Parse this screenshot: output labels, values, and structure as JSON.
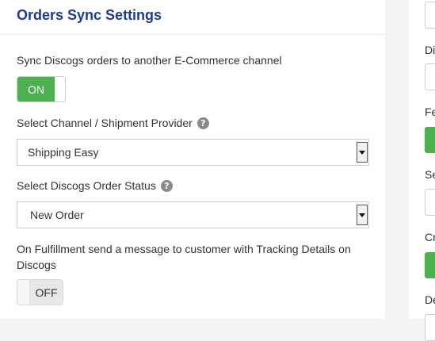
{
  "panel": {
    "title": "Orders Sync Settings"
  },
  "sync": {
    "label": "Sync Discogs orders to another E-Commerce channel",
    "toggle_label": "ON"
  },
  "channel": {
    "label": "Select Channel / Shipment Provider",
    "value": "Shipping Easy"
  },
  "status": {
    "label": "Select Discogs Order Status",
    "value": "New Order"
  },
  "fulfillment": {
    "label": "On Fulfillment send a message to customer with Tracking Details on Discogs",
    "toggle_label": "OFF"
  },
  "help_icon_glyph": "?",
  "right_panel": {
    "labels": [
      "Di",
      "Fe",
      "Se",
      "Cr",
      "De"
    ]
  },
  "colors": {
    "title": "#1f3b8f",
    "toggle_on": "#4caf50",
    "help_icon": "#8a8a8a"
  }
}
